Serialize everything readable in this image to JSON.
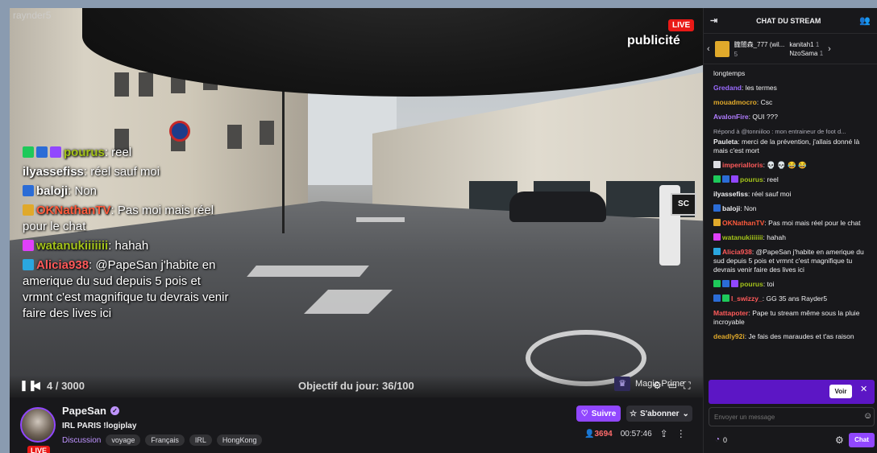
{
  "video": {
    "watermark": "raynder5",
    "live_badge": "LIVE",
    "ad_label": "publicité",
    "sc_logo": "SC",
    "viewer_counter": "4 / 3000",
    "daily_goal": "Objectif du jour: 36/100",
    "prime_label": "Magic Prime",
    "overlay_chat": [
      {
        "user": "pourus",
        "sep": ": ",
        "text": "reel",
        "color": "#a3c21a",
        "badges": [
          "#1ec95a",
          "#2b6cd6",
          "#9147ff"
        ]
      },
      {
        "user": "ilyassefiss",
        "sep": ": ",
        "text": "réel sauf moi",
        "color": "#ffffff",
        "badges": []
      },
      {
        "user": "baloji",
        "sep": ": ",
        "text": "Non",
        "color": "#ffffff",
        "badges": [
          "#2b6cd6"
        ]
      },
      {
        "user": "OKNathanTV",
        "sep": ": ",
        "text": "Pas moi mais réel pour le chat",
        "color": "#ff5a3c",
        "badges": [
          "#e0a92b"
        ]
      },
      {
        "user": "watanukiiiiiii",
        "sep": ": ",
        "text": "hahah",
        "color": "#a3c21a",
        "badges": [
          "#e040fb"
        ]
      },
      {
        "user": "Alicia938",
        "sep": ": ",
        "text": "@PapeSan j'habite en amerique du sud depuis 5 pois et vrmnt c'est magnifique tu devrais venir faire des lives ici",
        "color": "#ff5a5a",
        "badges": [
          "#2aa7e0"
        ]
      }
    ]
  },
  "channel": {
    "name": "PapeSan",
    "avatar_live": "LIVE",
    "title": "IRL PARIS !logiplay",
    "category": "Discussion",
    "tags": [
      "voyage",
      "Français",
      "IRL",
      "HongKong"
    ],
    "follow_label": "Suivre",
    "subscribe_label": "S'abonner",
    "viewers": "3694",
    "uptime": "00:57:46"
  },
  "chat": {
    "title": "CHAT DU STREAM",
    "gifts": [
      {
        "name": "朧闇森_777 (wil...",
        "count": "5"
      },
      {
        "name": "kanitah1",
        "count": "1"
      },
      {
        "name": "NzoSama",
        "count": "1"
      }
    ],
    "messages": [
      {
        "user": "",
        "text": "longtemps",
        "color": "#efeff1",
        "badges": []
      },
      {
        "user": "Gredand",
        "text": "les termes",
        "color": "#9b6bff",
        "badges": []
      },
      {
        "user": "mouadmocro",
        "text": "Csc",
        "color": "#e0a92b",
        "badges": []
      },
      {
        "user": "AvalonFire",
        "text": "QUI ???",
        "color": "#b07cff",
        "badges": []
      },
      {
        "user": "Pauleta",
        "text": "merci de la prévention, j'allais donné là mais c'est mort",
        "color": "#efeff1",
        "badges": [],
        "reply": "Répond à @tonniiloo : mon entraineur de foot d..."
      },
      {
        "user": "imperialloris",
        "text": "💀 💀 😂 😂",
        "color": "#ff5a5a",
        "badges": [
          "#dedee3"
        ]
      },
      {
        "user": "pourus",
        "text": "reel",
        "color": "#a3c21a",
        "badges": [
          "#1ec95a",
          "#2b6cd6",
          "#9147ff"
        ]
      },
      {
        "user": "ilyassefiss",
        "text": "réel sauf moi",
        "color": "#efeff1",
        "badges": []
      },
      {
        "user": "baloji",
        "text": "Non",
        "color": "#efeff1",
        "badges": [
          "#2b6cd6"
        ]
      },
      {
        "user": "OKNathanTV",
        "text": "Pas moi mais réel pour le chat",
        "color": "#ff5a3c",
        "badges": [
          "#e0a92b"
        ]
      },
      {
        "user": "watanukiiiiiii",
        "text": "hahah",
        "color": "#a3c21a",
        "badges": [
          "#e040fb"
        ]
      },
      {
        "user": "Alicia938",
        "text": "@PapeSan j'habite en amerique du sud depuis 5 pois et vrmnt c'est magnifique tu devrais venir faire des lives ici",
        "color": "#ff5a5a",
        "badges": [
          "#2aa7e0"
        ]
      },
      {
        "user": "pourus",
        "text": "toi",
        "color": "#a3c21a",
        "badges": [
          "#1ec95a",
          "#2b6cd6",
          "#9147ff"
        ]
      },
      {
        "user": "l_swizzy_",
        "text": "GG 35 ans Rayder5",
        "color": "#ff5a5a",
        "badges": [
          "#2b6cd6",
          "#1ec95a"
        ]
      },
      {
        "user": "Mattapoter",
        "text": "Pape tu stream même sous la pluie incroyable",
        "color": "#ff5a5a",
        "badges": []
      },
      {
        "user": "deadly92i",
        "text": "Je fais des maraudes et t'as raison",
        "color": "#e0a92b",
        "badges": []
      }
    ],
    "voir_label": "Voir",
    "input_placeholder": "Envoyer un message",
    "points": "0",
    "chat_button": "Chat"
  }
}
